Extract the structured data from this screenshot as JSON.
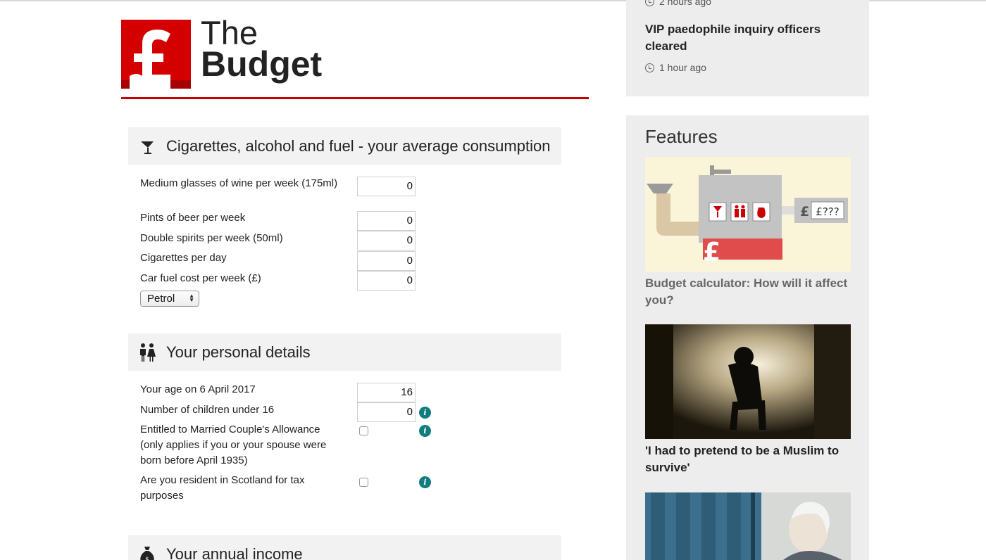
{
  "logo": {
    "line1": "The",
    "line2": "Budget"
  },
  "sections": {
    "consumption": {
      "title": "Cigarettes, alcohol and fuel - your average consumption",
      "fields": [
        {
          "label": "Medium glasses of wine per week (175ml)",
          "value": "0"
        },
        {
          "label": "Pints of beer per week",
          "value": "0"
        },
        {
          "label": "Double spirits per week (50ml)",
          "value": "0"
        },
        {
          "label": "Cigarettes per day",
          "value": "0"
        },
        {
          "label": "Car fuel cost per week (£)",
          "value": "0"
        }
      ],
      "fuel_select": {
        "value": "Petrol"
      }
    },
    "personal": {
      "title": "Your personal details",
      "age_label": "Your age on 6 April 2017",
      "age_value": "16",
      "children_label": "Number of children under 16",
      "children_value": "0",
      "married_label": "Entitled to Married Couple's Allowance (only applies if you or your spouse were born before April 1935)",
      "married_checked": false,
      "scotland_label": "Are you resident in Scotland for tax purposes",
      "scotland_checked": false,
      "info_glyph": "i"
    },
    "income": {
      "title": "Your annual income"
    }
  },
  "sidebar": {
    "news": {
      "time_top": "2 hours ago",
      "headline": "VIP paedophile inquiry officers cleared",
      "time": "1 hour ago"
    },
    "features": {
      "title": "Features",
      "items": [
        {
          "caption": "Budget calculator: How will it affect you?",
          "img_text": "£???"
        },
        {
          "caption": "'I had to pretend to be a Muslim to survive'"
        },
        {
          "caption": ""
        }
      ]
    }
  },
  "colors": {
    "brand_red": "#c50000",
    "info_teal": "#0f7d80",
    "panel_grey": "#ededed",
    "caption_grey": "#666666"
  }
}
